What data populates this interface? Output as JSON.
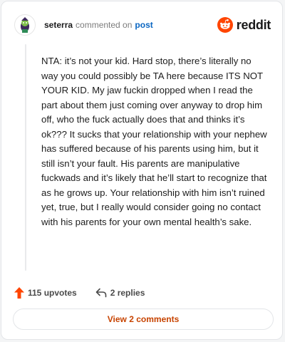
{
  "header": {
    "username": "seterra",
    "action_text": "commented on",
    "post_link": "post",
    "brand": "reddit"
  },
  "comment": {
    "body": "NTA: it’s not your kid. Hard stop, there’s literally no way you could possibly be TA here because ITS NOT YOUR KID. My jaw fuckin dropped when I read the part about them just coming over anyway to drop him off, who the fuck actually does that and thinks it’s ok??? It sucks that your relationship with your nephew has suffered because of his parents using him, but it still isn’t your fault. His parents are manipulative fuckwads and it’s likely that he’ll start to recognize that as he grows up. Your relationship with him isn’t ruined yet, true, but I really would consider going no contact with his parents for your own mental health’s sake."
  },
  "actions": {
    "upvotes": "115 upvotes",
    "replies": "2 replies",
    "upvote_icon": "up-arrow-icon",
    "reply_icon": "reply-arrow-icon"
  },
  "footer": {
    "view_comments": "View 2 comments"
  },
  "colors": {
    "accent": "#ff4500",
    "link": "#0a66c2",
    "view_button_text": "#c74300"
  }
}
